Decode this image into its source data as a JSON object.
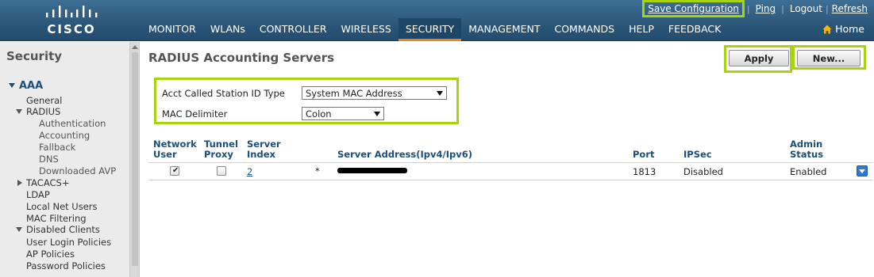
{
  "brand": {
    "logo_text": "CISCO"
  },
  "utility_links": [
    "Save Configuration",
    "Ping",
    "Logout",
    "Refresh"
  ],
  "nav": {
    "tabs": [
      "MONITOR",
      "WLANs",
      "CONTROLLER",
      "WIRELESS",
      "SECURITY",
      "MANAGEMENT",
      "COMMANDS",
      "HELP",
      "FEEDBACK"
    ],
    "active_tab": "SECURITY",
    "home_label": "Home"
  },
  "sidebar": {
    "title": "Security",
    "items": {
      "aaa": "AAA",
      "general": "General",
      "radius": "RADIUS",
      "authentication": "Authentication",
      "accounting": "Accounting",
      "fallback": "Fallback",
      "dns": "DNS",
      "downloaded_avp": "Downloaded AVP",
      "tacacs": "TACACS+",
      "ldap": "LDAP",
      "local_net_users": "Local Net Users",
      "mac_filtering": "MAC Filtering",
      "disabled_clients": "Disabled Clients",
      "user_login_policies": "User Login Policies",
      "ap_policies": "AP Policies",
      "password_policies": "Password Policies"
    }
  },
  "page": {
    "title": "RADIUS Accounting Servers",
    "apply_label": "Apply",
    "new_label": "New..."
  },
  "settings": {
    "station_id_label": "Acct Called Station ID Type",
    "station_id_value": "System MAC Address",
    "mac_delim_label": "MAC Delimiter",
    "mac_delim_value": "Colon"
  },
  "table": {
    "headers": {
      "network_user": [
        "Network",
        "User"
      ],
      "tunnel_proxy": [
        "Tunnel",
        "Proxy"
      ],
      "server_index": [
        "Server",
        "Index"
      ],
      "server_address": "Server Address(Ipv4/Ipv6)",
      "port": "Port",
      "ipsec": "IPSec",
      "admin_status": [
        "Admin",
        "Status"
      ]
    },
    "rows": [
      {
        "network_user": true,
        "tunnel_proxy": false,
        "server_index": "2",
        "marker": "*",
        "port": "1813",
        "ipsec": "Disabled",
        "admin_status": "Enabled"
      }
    ]
  },
  "colors": {
    "highlight": "#a6d40e",
    "header_bg": "#2b5679",
    "active_tab_accent": "#e9861c",
    "link": "#1a4f9a"
  }
}
